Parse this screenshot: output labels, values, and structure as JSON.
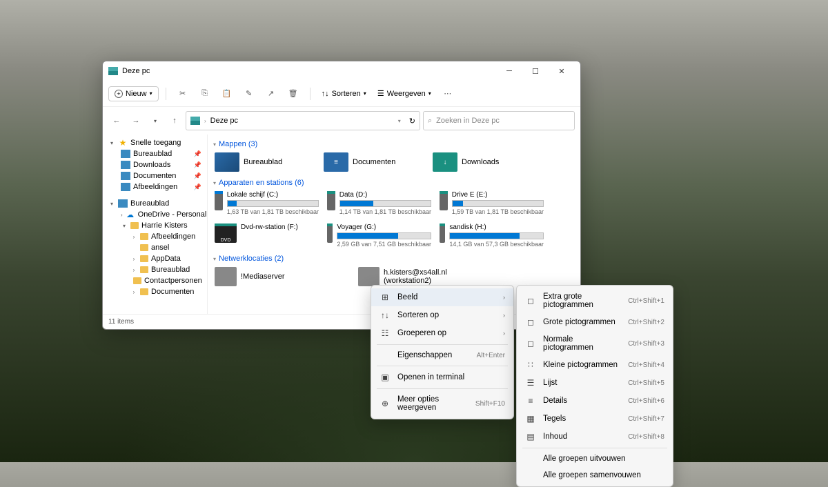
{
  "window": {
    "title": "Deze pc",
    "new_button": "Nieuw",
    "sort_label": "Sorteren",
    "view_label": "Weergeven",
    "address": "Deze pc",
    "search_placeholder": "Zoeken in Deze pc",
    "status": "11 items"
  },
  "sidebar": {
    "quick_access": "Snelle toegang",
    "pinned": [
      "Bureaublad",
      "Downloads",
      "Documenten",
      "Afbeeldingen"
    ],
    "desktop": "Bureaublad",
    "onedrive": "OneDrive - Personal",
    "user": "Harrie Kisters",
    "user_items": [
      "Afbeeldingen",
      "ansel",
      "AppData",
      "Bureaublad",
      "Contactpersonen",
      "Documenten"
    ]
  },
  "groups": {
    "folders_header": "Mappen (3)",
    "drives_header": "Apparaten en stations (6)",
    "network_header": "Netwerklocaties (2)"
  },
  "folders": [
    {
      "name": "Bureaublad"
    },
    {
      "name": "Documenten"
    },
    {
      "name": "Downloads"
    }
  ],
  "drives": [
    {
      "name": "Lokale schijf (C:)",
      "free": "1,63 TB van 1,81 TB beschikbaar",
      "pct": 10
    },
    {
      "name": "Data (D:)",
      "free": "1,14 TB van 1,81 TB beschikbaar",
      "pct": 37
    },
    {
      "name": "Drive E (E:)",
      "free": "1,59 TB van 1,81 TB beschikbaar",
      "pct": 12
    },
    {
      "name": "Dvd-rw-station (F:)",
      "free": "",
      "pct": null
    },
    {
      "name": "Voyager (G:)",
      "free": "2,59 GB van 7,51 GB beschikbaar",
      "pct": 65
    },
    {
      "name": "sandisk (H:)",
      "free": "14,1 GB van 57,3 GB beschikbaar",
      "pct": 75
    }
  ],
  "network": [
    {
      "name": "!Mediaserver"
    },
    {
      "name": "h.kisters@xs4all.nl (workstation2)"
    }
  ],
  "context_menu_1": [
    {
      "label": "Beeld",
      "icon": "grid",
      "submenu": true,
      "hl": true
    },
    {
      "label": "Sorteren op",
      "icon": "sort",
      "submenu": true
    },
    {
      "label": "Groeperen op",
      "icon": "group",
      "submenu": true
    },
    {
      "sep": true
    },
    {
      "label": "Eigenschappen",
      "icon": "",
      "hint": "Alt+Enter"
    },
    {
      "sep": true
    },
    {
      "label": "Openen in terminal",
      "icon": "terminal"
    },
    {
      "sep": true
    },
    {
      "label": "Meer opties weergeven",
      "icon": "more",
      "hint": "Shift+F10"
    }
  ],
  "context_menu_2": [
    {
      "label": "Extra grote pictogrammen",
      "icon": "xl",
      "hint": "Ctrl+Shift+1"
    },
    {
      "label": "Grote pictogrammen",
      "icon": "lg",
      "hint": "Ctrl+Shift+2"
    },
    {
      "label": "Normale pictogrammen",
      "icon": "md",
      "hint": "Ctrl+Shift+3"
    },
    {
      "label": "Kleine pictogrammen",
      "icon": "sm",
      "hint": "Ctrl+Shift+4"
    },
    {
      "label": "Lijst",
      "icon": "list",
      "hint": "Ctrl+Shift+5"
    },
    {
      "label": "Details",
      "icon": "details",
      "hint": "Ctrl+Shift+6"
    },
    {
      "label": "Tegels",
      "icon": "tiles",
      "hint": "Ctrl+Shift+7"
    },
    {
      "label": "Inhoud",
      "icon": "content",
      "hint": "Ctrl+Shift+8"
    },
    {
      "sep": true
    },
    {
      "label": "Alle groepen uitvouwen"
    },
    {
      "label": "Alle groepen samenvouwen"
    }
  ]
}
